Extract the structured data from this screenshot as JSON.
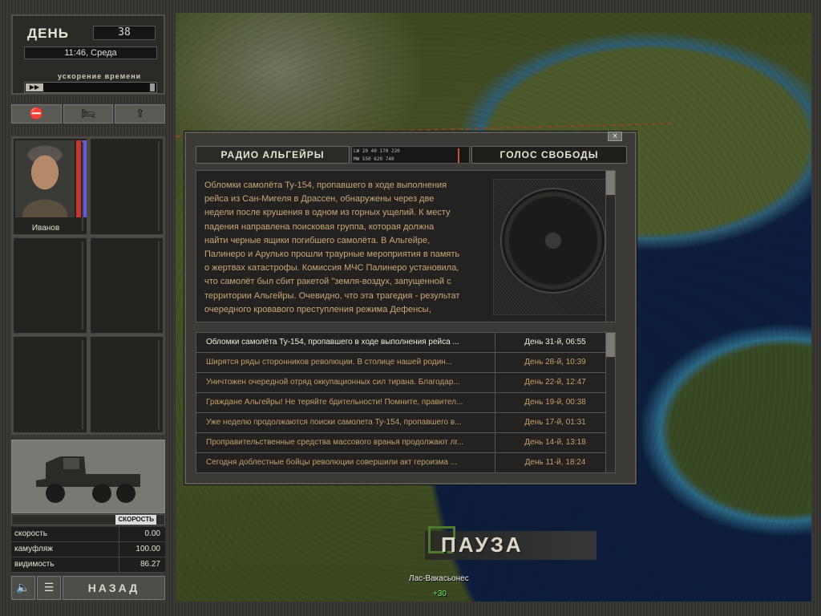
{
  "clock": {
    "day_label": "ДЕНЬ",
    "day_value": "38",
    "time": "11:46, Среда",
    "accel_label": "ускорение времени"
  },
  "squad": {
    "merc_name": "Иванов"
  },
  "vehicle": {
    "speed_label": "СКОРОСТЬ",
    "stats": [
      {
        "label": "скорость",
        "value": "0.00"
      },
      {
        "label": "камуфляж",
        "value": "100.00"
      },
      {
        "label": "видимость",
        "value": "86.27"
      }
    ],
    "back_label": "НАЗАД"
  },
  "radio": {
    "station_left": "РАДИО АЛЬГЕЙРЫ",
    "station_right": "ГОЛОС СВОБОДЫ",
    "dial_lw": "LW     20    40    170   220",
    "dial_mw": "MW     550   620   740",
    "close_glyph": "×",
    "article": "Обломки самолёта Ту-154, пропавшего в ходе выполнения\nрейса из Сан-Мигеля в Драссен, обнаружены через две\nнедели после крушения в одном из горных ущелий. К месту\nпадения направлена поисковая группа, которая должна\nнайти черные ящики погибшего самолёта. В Альгейре,\nПалинеро и Арулько прошли траурные мероприятия в память\nо жертвах катастрофы. Комиссия МЧС Палинеро установила,\nчто самолёт был сбит ракетой \"земля-воздух, запущенной с\nтерритории Альгейры. Очевидно, что эта трагедия - результат\nочередного кровавого преступления режима Дефенсы,",
    "items": [
      {
        "title": "Обломки самолёта Ту-154, пропавшего в ходе выполнения рейса ...",
        "date": "День 31-й, 06:55"
      },
      {
        "title": "Ширятся ряды сторонников революции. В столице нашей родин...",
        "date": "День 28-й, 10:39"
      },
      {
        "title": "Уничтожен очередной отряд оккупационных сил тирана. Благодар...",
        "date": "День 22-й, 12:47"
      },
      {
        "title": "Граждане Альгейры! Не теряйте бдительности! Помните, правител...",
        "date": "День 19-й, 00:38"
      },
      {
        "title": "Уже неделю продолжаются поиски самолета Ту-154, пропавшего в...",
        "date": "День 17-й, 01:31"
      },
      {
        "title": "Проправительственные средства массового вранья продолжают лг...",
        "date": "День 14-й, 13:18"
      },
      {
        "title": "Сегодня доблестные бойцы революции совершили акт героизма ...",
        "date": "День 11-й, 18:24"
      }
    ]
  },
  "map": {
    "pause_label": "ПАУЗА",
    "town_name": "Лас-Вакасьонес",
    "town_count": "+30"
  }
}
